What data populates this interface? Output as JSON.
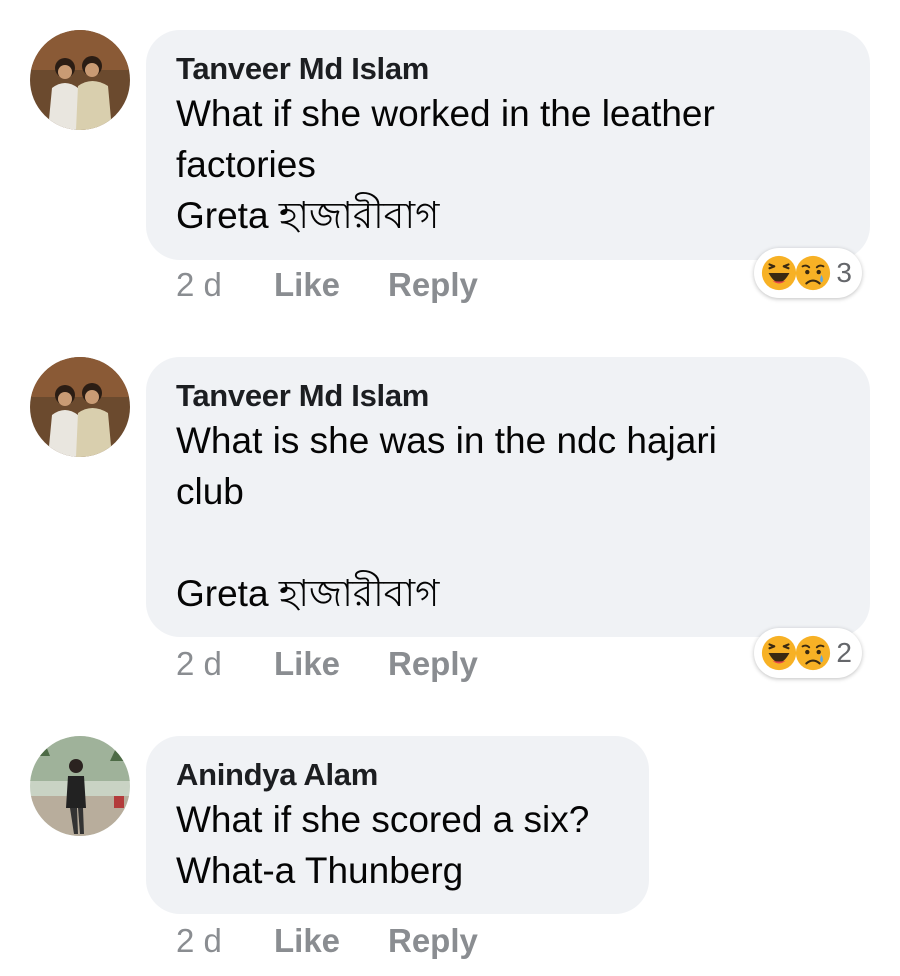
{
  "comments": [
    {
      "author": "Tanveer Md Islam",
      "text": "What if she worked in the leather\nfactories\nGreta হাজারীবাগ",
      "time": "2 d",
      "like_label": "Like",
      "reply_label": "Reply",
      "reactions": [
        "haha",
        "sad"
      ],
      "reaction_count": "3"
    },
    {
      "author": "Tanveer Md Islam",
      "text": "What is she was in the ndc hajari\nclub\n\nGreta হাজারীবাগ",
      "time": "2 d",
      "like_label": "Like",
      "reply_label": "Reply",
      "reactions": [
        "haha",
        "sad"
      ],
      "reaction_count": "2"
    },
    {
      "author": "Anindya Alam",
      "text": "What if she scored a six?\nWhat-a Thunberg",
      "time": "2 d",
      "like_label": "Like",
      "reply_label": "Reply"
    }
  ],
  "colors": {
    "bubble": "#f0f2f5",
    "meta_text": "#8a8d91",
    "emoji_yellow": "#f7b125"
  }
}
